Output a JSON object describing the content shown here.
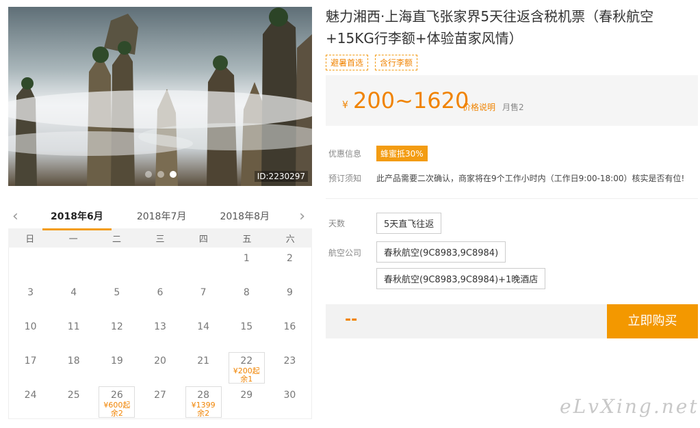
{
  "photo": {
    "id_label": "ID:2230297",
    "slides": 3,
    "active_slide": 3
  },
  "calendar": {
    "months": [
      "2018年6月",
      "2018年7月",
      "2018年8月"
    ],
    "active_month": 0,
    "weekdays": [
      "日",
      "一",
      "二",
      "三",
      "四",
      "五",
      "六"
    ],
    "weeks": [
      [
        {
          "d": ""
        },
        {
          "d": ""
        },
        {
          "d": ""
        },
        {
          "d": ""
        },
        {
          "d": ""
        },
        {
          "d": "1"
        },
        {
          "d": "2"
        }
      ],
      [
        {
          "d": "3"
        },
        {
          "d": "4"
        },
        {
          "d": "5"
        },
        {
          "d": "6"
        },
        {
          "d": "7"
        },
        {
          "d": "8"
        },
        {
          "d": "9"
        }
      ],
      [
        {
          "d": "10"
        },
        {
          "d": "11"
        },
        {
          "d": "12"
        },
        {
          "d": "13"
        },
        {
          "d": "14"
        },
        {
          "d": "15"
        },
        {
          "d": "16"
        }
      ],
      [
        {
          "d": "17"
        },
        {
          "d": "18"
        },
        {
          "d": "19"
        },
        {
          "d": "20"
        },
        {
          "d": "21"
        },
        {
          "d": "22",
          "price": "¥200起",
          "remain": "余1"
        },
        {
          "d": "23"
        }
      ],
      [
        {
          "d": "24"
        },
        {
          "d": "25"
        },
        {
          "d": "26",
          "price": "¥600起",
          "remain": "余2"
        },
        {
          "d": "27"
        },
        {
          "d": "28",
          "price": "¥1399",
          "remain": "余2"
        },
        {
          "d": "29"
        },
        {
          "d": "30"
        }
      ]
    ]
  },
  "product": {
    "title": "魅力湘西·上海直飞张家界5天往返含税机票（春秋航空+15KG行李额+体验苗家风情）",
    "tags": [
      "避暑首选",
      "含行李额"
    ],
    "price": {
      "currency": "¥",
      "range": "200~1620",
      "desc_link": "价格说明",
      "sold": "月售2"
    },
    "promo": {
      "label": "优惠信息",
      "badge": "蜂蜜抵30%"
    },
    "notice": {
      "label": "预订须知",
      "text": "此产品需要二次确认，商家将在9个工作小时内（工作日9:00-18:00）核实是否有位!"
    },
    "days": {
      "label": "天数",
      "option": "5天直飞往返"
    },
    "airline": {
      "label": "航空公司",
      "options": [
        "春秋航空(9C8983,9C8984)",
        "春秋航空(9C8983,9C8984)+1晚酒店"
      ]
    },
    "total": "--",
    "buy_label": "立即购买"
  },
  "watermark": "eLvXing.net",
  "colors": {
    "accent": "#f39800",
    "price": "#f08300"
  }
}
